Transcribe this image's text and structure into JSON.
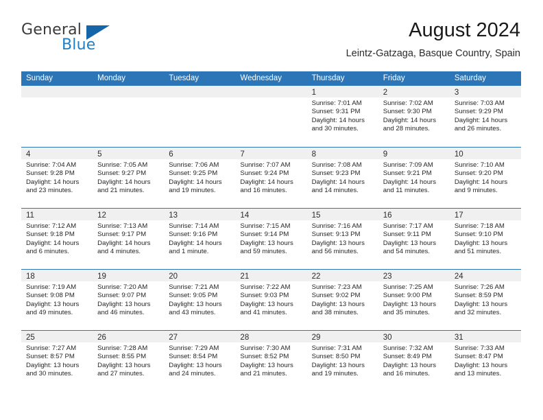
{
  "brand": {
    "word_general": "General",
    "word_blue": "Blue",
    "logo_icon": "triangle-logo-icon"
  },
  "header": {
    "title": "August 2024",
    "subtitle": "Leintz-Gatzaga, Basque Country, Spain"
  },
  "colors": {
    "header_blue": "#2c76b8",
    "day_band_gray": "#f0f0f0",
    "brand_blue": "#1f7fc4",
    "text": "#262626"
  },
  "weekdays": [
    "Sunday",
    "Monday",
    "Tuesday",
    "Wednesday",
    "Thursday",
    "Friday",
    "Saturday"
  ],
  "weeks": [
    [
      {
        "day": "",
        "sunrise": "",
        "sunset": "",
        "daylight": ""
      },
      {
        "day": "",
        "sunrise": "",
        "sunset": "",
        "daylight": ""
      },
      {
        "day": "",
        "sunrise": "",
        "sunset": "",
        "daylight": ""
      },
      {
        "day": "",
        "sunrise": "",
        "sunset": "",
        "daylight": ""
      },
      {
        "day": "1",
        "sunrise": "Sunrise: 7:01 AM",
        "sunset": "Sunset: 9:31 PM",
        "daylight": "Daylight: 14 hours and 30 minutes."
      },
      {
        "day": "2",
        "sunrise": "Sunrise: 7:02 AM",
        "sunset": "Sunset: 9:30 PM",
        "daylight": "Daylight: 14 hours and 28 minutes."
      },
      {
        "day": "3",
        "sunrise": "Sunrise: 7:03 AM",
        "sunset": "Sunset: 9:29 PM",
        "daylight": "Daylight: 14 hours and 26 minutes."
      }
    ],
    [
      {
        "day": "4",
        "sunrise": "Sunrise: 7:04 AM",
        "sunset": "Sunset: 9:28 PM",
        "daylight": "Daylight: 14 hours and 23 minutes."
      },
      {
        "day": "5",
        "sunrise": "Sunrise: 7:05 AM",
        "sunset": "Sunset: 9:27 PM",
        "daylight": "Daylight: 14 hours and 21 minutes."
      },
      {
        "day": "6",
        "sunrise": "Sunrise: 7:06 AM",
        "sunset": "Sunset: 9:25 PM",
        "daylight": "Daylight: 14 hours and 19 minutes."
      },
      {
        "day": "7",
        "sunrise": "Sunrise: 7:07 AM",
        "sunset": "Sunset: 9:24 PM",
        "daylight": "Daylight: 14 hours and 16 minutes."
      },
      {
        "day": "8",
        "sunrise": "Sunrise: 7:08 AM",
        "sunset": "Sunset: 9:23 PM",
        "daylight": "Daylight: 14 hours and 14 minutes."
      },
      {
        "day": "9",
        "sunrise": "Sunrise: 7:09 AM",
        "sunset": "Sunset: 9:21 PM",
        "daylight": "Daylight: 14 hours and 11 minutes."
      },
      {
        "day": "10",
        "sunrise": "Sunrise: 7:10 AM",
        "sunset": "Sunset: 9:20 PM",
        "daylight": "Daylight: 14 hours and 9 minutes."
      }
    ],
    [
      {
        "day": "11",
        "sunrise": "Sunrise: 7:12 AM",
        "sunset": "Sunset: 9:18 PM",
        "daylight": "Daylight: 14 hours and 6 minutes."
      },
      {
        "day": "12",
        "sunrise": "Sunrise: 7:13 AM",
        "sunset": "Sunset: 9:17 PM",
        "daylight": "Daylight: 14 hours and 4 minutes."
      },
      {
        "day": "13",
        "sunrise": "Sunrise: 7:14 AM",
        "sunset": "Sunset: 9:16 PM",
        "daylight": "Daylight: 14 hours and 1 minute."
      },
      {
        "day": "14",
        "sunrise": "Sunrise: 7:15 AM",
        "sunset": "Sunset: 9:14 PM",
        "daylight": "Daylight: 13 hours and 59 minutes."
      },
      {
        "day": "15",
        "sunrise": "Sunrise: 7:16 AM",
        "sunset": "Sunset: 9:13 PM",
        "daylight": "Daylight: 13 hours and 56 minutes."
      },
      {
        "day": "16",
        "sunrise": "Sunrise: 7:17 AM",
        "sunset": "Sunset: 9:11 PM",
        "daylight": "Daylight: 13 hours and 54 minutes."
      },
      {
        "day": "17",
        "sunrise": "Sunrise: 7:18 AM",
        "sunset": "Sunset: 9:10 PM",
        "daylight": "Daylight: 13 hours and 51 minutes."
      }
    ],
    [
      {
        "day": "18",
        "sunrise": "Sunrise: 7:19 AM",
        "sunset": "Sunset: 9:08 PM",
        "daylight": "Daylight: 13 hours and 49 minutes."
      },
      {
        "day": "19",
        "sunrise": "Sunrise: 7:20 AM",
        "sunset": "Sunset: 9:07 PM",
        "daylight": "Daylight: 13 hours and 46 minutes."
      },
      {
        "day": "20",
        "sunrise": "Sunrise: 7:21 AM",
        "sunset": "Sunset: 9:05 PM",
        "daylight": "Daylight: 13 hours and 43 minutes."
      },
      {
        "day": "21",
        "sunrise": "Sunrise: 7:22 AM",
        "sunset": "Sunset: 9:03 PM",
        "daylight": "Daylight: 13 hours and 41 minutes."
      },
      {
        "day": "22",
        "sunrise": "Sunrise: 7:23 AM",
        "sunset": "Sunset: 9:02 PM",
        "daylight": "Daylight: 13 hours and 38 minutes."
      },
      {
        "day": "23",
        "sunrise": "Sunrise: 7:25 AM",
        "sunset": "Sunset: 9:00 PM",
        "daylight": "Daylight: 13 hours and 35 minutes."
      },
      {
        "day": "24",
        "sunrise": "Sunrise: 7:26 AM",
        "sunset": "Sunset: 8:59 PM",
        "daylight": "Daylight: 13 hours and 32 minutes."
      }
    ],
    [
      {
        "day": "25",
        "sunrise": "Sunrise: 7:27 AM",
        "sunset": "Sunset: 8:57 PM",
        "daylight": "Daylight: 13 hours and 30 minutes."
      },
      {
        "day": "26",
        "sunrise": "Sunrise: 7:28 AM",
        "sunset": "Sunset: 8:55 PM",
        "daylight": "Daylight: 13 hours and 27 minutes."
      },
      {
        "day": "27",
        "sunrise": "Sunrise: 7:29 AM",
        "sunset": "Sunset: 8:54 PM",
        "daylight": "Daylight: 13 hours and 24 minutes."
      },
      {
        "day": "28",
        "sunrise": "Sunrise: 7:30 AM",
        "sunset": "Sunset: 8:52 PM",
        "daylight": "Daylight: 13 hours and 21 minutes."
      },
      {
        "day": "29",
        "sunrise": "Sunrise: 7:31 AM",
        "sunset": "Sunset: 8:50 PM",
        "daylight": "Daylight: 13 hours and 19 minutes."
      },
      {
        "day": "30",
        "sunrise": "Sunrise: 7:32 AM",
        "sunset": "Sunset: 8:49 PM",
        "daylight": "Daylight: 13 hours and 16 minutes."
      },
      {
        "day": "31",
        "sunrise": "Sunrise: 7:33 AM",
        "sunset": "Sunset: 8:47 PM",
        "daylight": "Daylight: 13 hours and 13 minutes."
      }
    ]
  ]
}
